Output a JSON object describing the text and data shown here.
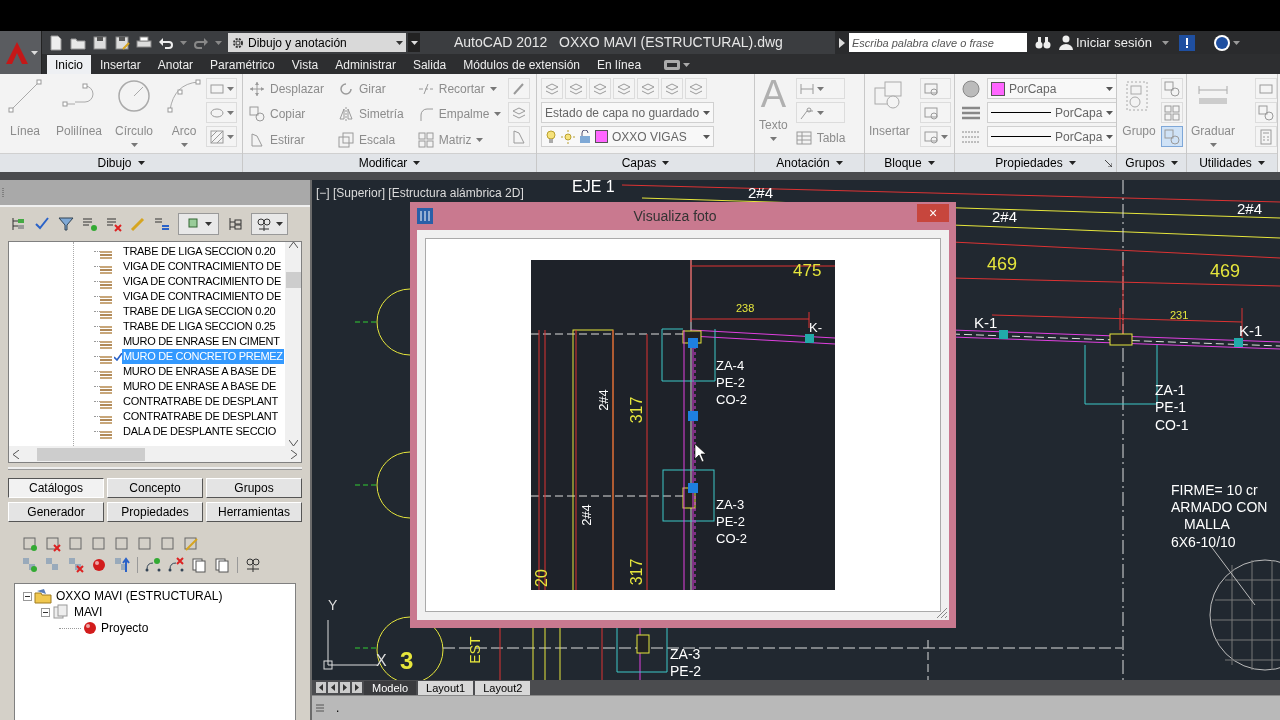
{
  "workspace": "Dibujo y anotación",
  "title": "AutoCAD 2012   OXXO MAVI (ESTRUCTURAL).dwg",
  "search": {
    "placeholder": "Escriba palabra clave o frase"
  },
  "sign_in": "Iniciar sesión",
  "ribbon_tabs": [
    {
      "label": "Inicio",
      "selected": true
    },
    {
      "label": "Insertar",
      "selected": false
    },
    {
      "label": "Anotar",
      "selected": false
    },
    {
      "label": "Paramétrico",
      "selected": false
    },
    {
      "label": "Vista",
      "selected": false
    },
    {
      "label": "Administrar",
      "selected": false
    },
    {
      "label": "Salida",
      "selected": false
    },
    {
      "label": "Módulos de extensión",
      "selected": false
    },
    {
      "label": "En línea",
      "selected": false
    }
  ],
  "ribbon_panels": [
    {
      "kind": "draw",
      "title": "Dibujo",
      "tools": [
        {
          "label": "Línea",
          "dropdown": false
        },
        {
          "label": "Polilínea",
          "dropdown": false
        },
        {
          "label": "Círculo",
          "dropdown": true
        },
        {
          "label": "Arco",
          "dropdown": true
        }
      ]
    },
    {
      "kind": "modify",
      "title": "Modificar",
      "tools": [
        {
          "label": "Desplazar",
          "dropdown": false
        },
        {
          "label": "Copiar",
          "dropdown": false
        },
        {
          "label": "Estirar",
          "dropdown": false
        },
        {
          "label": "Girar",
          "dropdown": false
        },
        {
          "label": "Simetría",
          "dropdown": false
        },
        {
          "label": "Escala",
          "dropdown": false
        },
        {
          "label": "Recortar",
          "dropdown": true
        },
        {
          "label": "Empalme",
          "dropdown": true
        },
        {
          "label": "Matriz",
          "dropdown": true
        }
      ]
    },
    {
      "kind": "layers",
      "title": "Capas",
      "combos": [
        {
          "value": "Estado de capa no guardado"
        },
        {
          "value": "OXXO VIGAS",
          "color": "#ff66ff"
        }
      ]
    },
    {
      "kind": "annotation",
      "title": "Anotación",
      "tools": [
        {
          "label": "Texto",
          "glyph": "A",
          "dropdown": true
        },
        {
          "label": "Tabla",
          "dropdown": false
        }
      ]
    },
    {
      "kind": "block",
      "title": "Bloque",
      "tools": [
        {
          "label": "Insertar",
          "dropdown": false
        }
      ]
    },
    {
      "kind": "properties",
      "title": "Propiedades",
      "combos": [
        {
          "value": "PorCapa",
          "color": "#ff66ff"
        },
        {
          "value": "PorCapa"
        },
        {
          "value": "PorCapa"
        }
      ]
    },
    {
      "kind": "groups",
      "title": "Grupos",
      "tools": [
        {
          "label": "Grupo",
          "dropdown": false
        }
      ]
    },
    {
      "kind": "utilities",
      "title": "Utilidades",
      "tools": [
        {
          "label": "Graduar",
          "dropdown": true
        }
      ]
    }
  ],
  "catalog_items": [
    {
      "label": "TRABE DE LIGA SECCION 0.20",
      "checked": false,
      "selected": false
    },
    {
      "label": "VIGA DE CONTRACIMIENTO DE",
      "checked": false,
      "selected": false
    },
    {
      "label": "VIGA DE CONTRACIMIENTO DE",
      "checked": false,
      "selected": false
    },
    {
      "label": "VIGA DE CONTRACIMIENTO DE",
      "checked": false,
      "selected": false
    },
    {
      "label": "TRABE DE LIGA SECCION 0.20",
      "checked": false,
      "selected": false
    },
    {
      "label": "TRABE DE LIGA SECCION 0.25",
      "checked": false,
      "selected": false
    },
    {
      "label": "MURO DE ENRASE EN CIMENT",
      "checked": false,
      "selected": false
    },
    {
      "label": "MURO DE CONCRETO PREMEZ",
      "checked": true,
      "selected": true
    },
    {
      "label": "MURO DE ENRASE A BASE DE",
      "checked": false,
      "selected": false
    },
    {
      "label": "MURO DE ENRASE A BASE DE",
      "checked": false,
      "selected": false
    },
    {
      "label": "CONTRATRABE DE DESPLANT",
      "checked": false,
      "selected": false
    },
    {
      "label": "CONTRATRABE DE DESPLANT",
      "checked": false,
      "selected": false
    },
    {
      "label": "DALA DE DESPLANTE SECCIO",
      "checked": false,
      "selected": false
    }
  ],
  "palette_tabs": [
    {
      "label": "Catálogos",
      "selected": true
    },
    {
      "label": "Concepto",
      "selected": false
    },
    {
      "label": "Grupos",
      "selected": false
    },
    {
      "label": "Generador",
      "selected": false
    },
    {
      "label": "Propiedades",
      "selected": false
    },
    {
      "label": "Herramientas",
      "selected": false
    }
  ],
  "project_tree": [
    {
      "label": "OXXO MAVI (ESTRUCTURAL)",
      "expanded": true,
      "children": [
        {
          "label": "MAVI",
          "expanded": true,
          "children": [
            {
              "label": "Proyecto"
            }
          ]
        }
      ]
    }
  ],
  "viewport_label": "[−] [Superior] [Estructura alámbrica 2D]",
  "drawing_texts": [
    "EJE  1",
    "2#4",
    "2#4",
    "2#4",
    "469",
    "469",
    "K-1",
    "231",
    "K-1",
    "ZA-1",
    "PE-1",
    "CO-1",
    "FIRME=  10  cr",
    "ARMADO  CON",
    "MALLA",
    "6X6-10/10",
    "3",
    "ZA-3",
    "PE-2",
    "Y",
    "X",
    "EST"
  ],
  "dialog": {
    "title": "Visualiza foto",
    "close": "×",
    "photo_texts": [
      "475",
      "238",
      "K-",
      "ZA-4",
      "PE-2",
      "CO-2",
      "ZA-3",
      "PE-2",
      "CO-2",
      "2#4",
      "317",
      "2#4",
      "317",
      "20"
    ]
  },
  "layout_tabs": [
    {
      "label": "Modelo",
      "selected": true
    },
    {
      "label": "Layout1",
      "selected": false
    },
    {
      "label": "Layout2",
      "selected": false
    }
  ],
  "command_line": "."
}
